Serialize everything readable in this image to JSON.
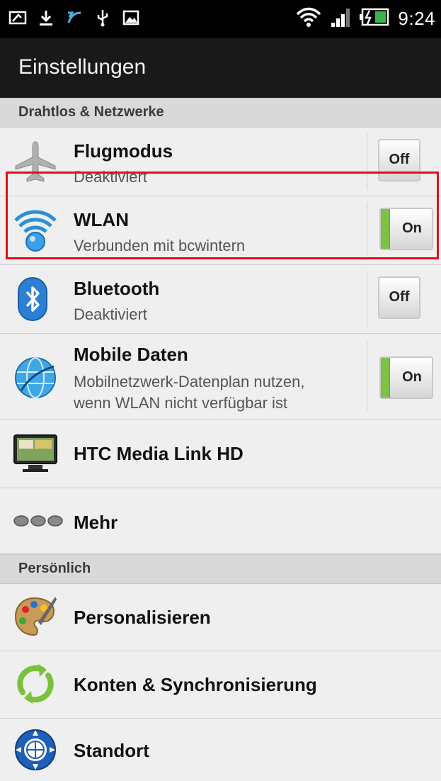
{
  "statusbar": {
    "time": "9:24"
  },
  "app": {
    "title": "Einstellungen"
  },
  "sections": {
    "wireless": "Drahtlos & Netzwerke",
    "personal": "Persönlich"
  },
  "items": {
    "flugmodus": {
      "title": "Flugmodus",
      "subtitle": "Deaktiviert",
      "toggle": "Off"
    },
    "wlan": {
      "title": "WLAN",
      "subtitle": "Verbunden mit bcwintern",
      "toggle": "On"
    },
    "bluetooth": {
      "title": "Bluetooth",
      "subtitle": "Deaktiviert",
      "toggle": "Off"
    },
    "mobile": {
      "title": "Mobile Daten",
      "subtitle_line1": "Mobilnetzwerk-Datenplan nutzen,",
      "subtitle_line2": "wenn WLAN nicht verfügbar ist",
      "toggle": "On"
    },
    "medialink": {
      "title": "HTC Media Link HD"
    },
    "mehr": {
      "title": "Mehr"
    },
    "personalisieren": {
      "title": "Personalisieren"
    },
    "konten": {
      "title": "Konten & Synchronisierung"
    },
    "standort": {
      "title": "Standort"
    }
  },
  "colors": {
    "toggle_on": "#7dc243",
    "highlight": "#e0101a"
  }
}
